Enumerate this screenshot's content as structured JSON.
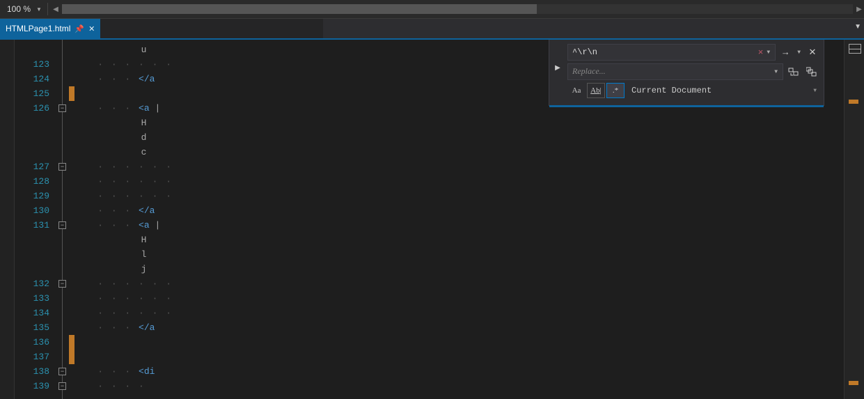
{
  "topbar": {
    "zoom_label": "100 %"
  },
  "tabs": {
    "active": {
      "label": "HTMLPage1.html"
    }
  },
  "find_panel": {
    "search_value": "^\\r\\n",
    "replace_placeholder": "Replace...",
    "match_case_label": "Aa",
    "whole_word_label": "Ab|",
    "regex_label": ".*",
    "scope_label": "Current Document"
  },
  "editor": {
    "lines": [
      {
        "num": "",
        "fold": "",
        "mark": false,
        "segs": [
          [
            "txt",
            "u"
          ]
        ]
      },
      {
        "num": "123",
        "fold": "",
        "mark": false,
        "segs": [
          [
            "dots",
            "· · · · · ·"
          ]
        ]
      },
      {
        "num": "124",
        "fold": "",
        "mark": false,
        "segs": [
          [
            "dots",
            "· · · "
          ],
          [
            "tag",
            "</a"
          ]
        ]
      },
      {
        "num": "125",
        "fold": "",
        "mark": true,
        "segs": []
      },
      {
        "num": "126",
        "fold": "box",
        "mark": false,
        "segs": [
          [
            "dots",
            "· · · "
          ],
          [
            "tag",
            "<a "
          ],
          [
            "txt",
            "|"
          ]
        ]
      },
      {
        "num": "",
        "fold": "",
        "mark": false,
        "segs": [
          [
            "txt",
            "H"
          ]
        ]
      },
      {
        "num": "",
        "fold": "",
        "mark": false,
        "segs": [
          [
            "txt",
            "d"
          ]
        ]
      },
      {
        "num": "",
        "fold": "",
        "mark": false,
        "segs": [
          [
            "txt",
            "c"
          ]
        ]
      },
      {
        "num": "127",
        "fold": "box",
        "mark": false,
        "segs": [
          [
            "dots",
            "· · · · · ·"
          ]
        ]
      },
      {
        "num": "128",
        "fold": "",
        "mark": false,
        "segs": [
          [
            "dots",
            "· · · · · ·"
          ]
        ]
      },
      {
        "num": "129",
        "fold": "",
        "mark": false,
        "segs": [
          [
            "dots",
            "· · · · · ·"
          ]
        ]
      },
      {
        "num": "130",
        "fold": "",
        "mark": false,
        "segs": [
          [
            "dots",
            "· · · "
          ],
          [
            "tag",
            "</a"
          ]
        ]
      },
      {
        "num": "131",
        "fold": "box",
        "mark": false,
        "segs": [
          [
            "dots",
            "· · · "
          ],
          [
            "tag",
            "<a "
          ],
          [
            "txt",
            "|"
          ]
        ]
      },
      {
        "num": "",
        "fold": "",
        "mark": false,
        "segs": [
          [
            "txt",
            "H"
          ]
        ]
      },
      {
        "num": "",
        "fold": "",
        "mark": false,
        "segs": [
          [
            "txt",
            "l"
          ]
        ]
      },
      {
        "num": "",
        "fold": "",
        "mark": false,
        "segs": [
          [
            "txt",
            "j"
          ]
        ]
      },
      {
        "num": "132",
        "fold": "box",
        "mark": false,
        "segs": [
          [
            "dots",
            "· · · · · ·"
          ]
        ]
      },
      {
        "num": "133",
        "fold": "",
        "mark": false,
        "segs": [
          [
            "dots",
            "· · · · · ·"
          ]
        ]
      },
      {
        "num": "134",
        "fold": "",
        "mark": false,
        "segs": [
          [
            "dots",
            "· · · · · ·"
          ]
        ]
      },
      {
        "num": "135",
        "fold": "",
        "mark": false,
        "segs": [
          [
            "dots",
            "· · · "
          ],
          [
            "tag",
            "</a"
          ]
        ]
      },
      {
        "num": "136",
        "fold": "",
        "mark": true,
        "segs": []
      },
      {
        "num": "137",
        "fold": "",
        "mark": true,
        "segs": []
      },
      {
        "num": "138",
        "fold": "box",
        "mark": false,
        "segs": [
          [
            "dots",
            "· · · "
          ],
          [
            "tag",
            "<di"
          ]
        ]
      },
      {
        "num": "139",
        "fold": "box",
        "mark": false,
        "segs": [
          [
            "dots",
            "· · · · "
          ]
        ]
      }
    ]
  }
}
